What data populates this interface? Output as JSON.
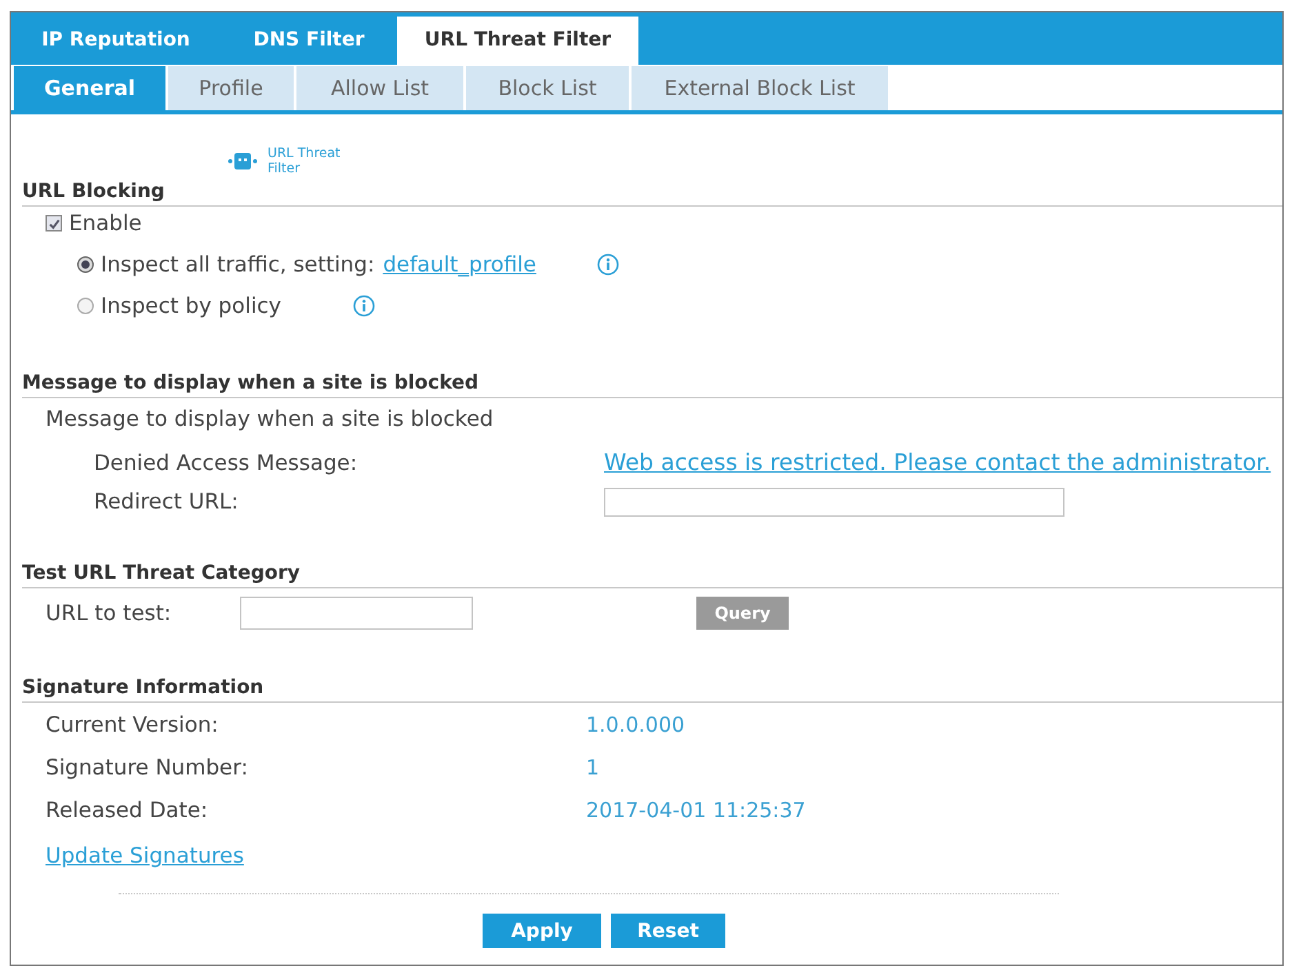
{
  "top_tabs": [
    {
      "label": "IP Reputation",
      "selected": false
    },
    {
      "label": "DNS Filter",
      "selected": false
    },
    {
      "label": "URL Threat Filter",
      "selected": true
    }
  ],
  "sub_tabs": [
    {
      "label": "General",
      "selected": true
    },
    {
      "label": "Profile",
      "selected": false
    },
    {
      "label": "Allow List",
      "selected": false
    },
    {
      "label": "Block List",
      "selected": false
    },
    {
      "label": "External Block List",
      "selected": false
    }
  ],
  "url_blocking": {
    "badge": "URL Threat Filter",
    "title": "URL Blocking",
    "enable": {
      "label": "Enable",
      "checked": true
    },
    "options": [
      {
        "label": "Inspect all traffic, setting:",
        "link": "default_profile",
        "selected": true
      },
      {
        "label": "Inspect by policy",
        "selected": false
      }
    ]
  },
  "message": {
    "title": "Message to display when a site is blocked",
    "subtitle": "Message to display when a site is blocked",
    "fields": [
      {
        "label": "Denied Access Message:",
        "kind": "link",
        "value": "Web access is restricted. Please contact the administrator."
      },
      {
        "label": "Redirect URL:",
        "kind": "input"
      }
    ]
  },
  "test": {
    "title": "Test URL Threat Category",
    "label": "URL to test:",
    "button": {
      "label": "Query",
      "disabled": true
    }
  },
  "signature": {
    "title": "Signature Information",
    "rows": [
      {
        "label": "Current Version:",
        "value": "1.0.0.000"
      },
      {
        "label": "Signature Number:",
        "value": "1"
      },
      {
        "label": "Released Date:",
        "value": "2017-04-01 11:25:37"
      }
    ],
    "link": "Update Signatures"
  },
  "buttons": [
    "Apply",
    "Reset"
  ]
}
